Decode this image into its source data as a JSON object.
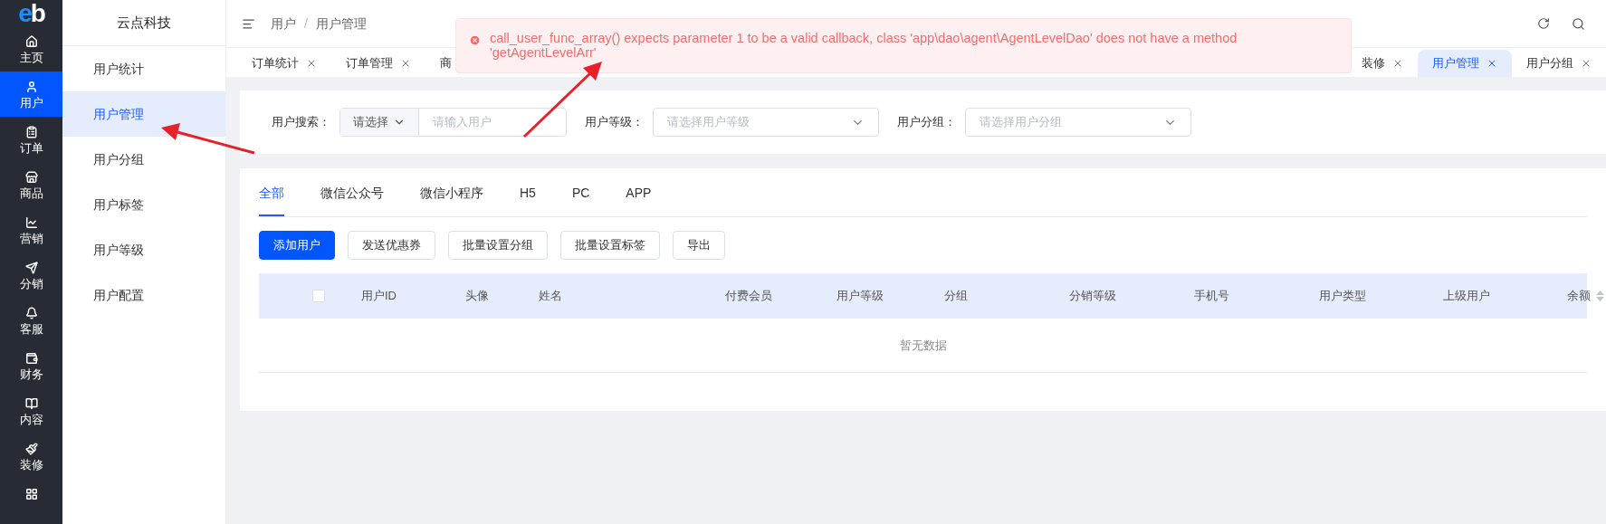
{
  "sidebar": {
    "logo_parts": [
      "e",
      "b"
    ],
    "items": [
      {
        "label": "主页",
        "selected": false
      },
      {
        "label": "用户",
        "selected": true
      },
      {
        "label": "订单",
        "selected": false
      },
      {
        "label": "商品",
        "selected": false
      },
      {
        "label": "营销",
        "selected": false
      },
      {
        "label": "分销",
        "selected": false
      },
      {
        "label": "客服",
        "selected": false
      },
      {
        "label": "财务",
        "selected": false
      },
      {
        "label": "内容",
        "selected": false
      },
      {
        "label": "装修",
        "selected": false
      },
      {
        "selected": false
      }
    ]
  },
  "submenu": {
    "title": "云点科技",
    "items": [
      {
        "label": "用户统计",
        "selected": false
      },
      {
        "label": "用户管理",
        "selected": true
      },
      {
        "label": "用户分组",
        "selected": false
      },
      {
        "label": "用户标签",
        "selected": false
      },
      {
        "label": "用户等级",
        "selected": false
      },
      {
        "label": "用户配置",
        "selected": false
      }
    ]
  },
  "header": {
    "breadcrumb": [
      "用户",
      "用户管理"
    ],
    "separator": "/"
  },
  "tabs": [
    {
      "label": "订单统计",
      "selected": false,
      "cut": false
    },
    {
      "label": "订单管理",
      "selected": false,
      "cut": false
    },
    {
      "label": "商",
      "selected": false,
      "cut": true
    },
    {
      "label": "装修",
      "selected": false,
      "cut": false
    },
    {
      "label": "用户管理",
      "selected": true,
      "cut": false
    },
    {
      "label": "用户分组",
      "selected": false,
      "cut": false
    }
  ],
  "error_toast": {
    "message": "call_user_func_array() expects parameter 1 to be a valid callback, class 'app\\dao\\agent\\AgentLevelDao' does not have a method 'getAgentLevelArr'"
  },
  "filters": {
    "user_search": {
      "label": "用户搜索：",
      "select_value": "请选择",
      "placeholder": "请输入用户"
    },
    "user_level": {
      "label": "用户等级：",
      "placeholder": "请选择用户等级"
    },
    "user_group": {
      "label": "用户分组：",
      "placeholder": "请选择用户分组"
    }
  },
  "channel_tabs": [
    {
      "label": "全部",
      "selected": true
    },
    {
      "label": "微信公众号",
      "selected": false
    },
    {
      "label": "微信小程序",
      "selected": false
    },
    {
      "label": "H5",
      "selected": false
    },
    {
      "label": "PC",
      "selected": false
    },
    {
      "label": "APP",
      "selected": false
    }
  ],
  "actions": [
    {
      "label": "添加用户",
      "kind": "primary"
    },
    {
      "label": "发送优惠券",
      "kind": "default"
    },
    {
      "label": "批量设置分组",
      "kind": "default"
    },
    {
      "label": "批量设置标签",
      "kind": "default"
    },
    {
      "label": "导出",
      "kind": "default"
    }
  ],
  "table": {
    "select_all": {
      "checked": false
    },
    "columns": [
      {
        "label": "用户ID",
        "sortable": false
      },
      {
        "label": "头像",
        "sortable": false
      },
      {
        "label": "姓名",
        "sortable": false
      },
      {
        "label": "付费会员",
        "sortable": false
      },
      {
        "label": "用户等级",
        "sortable": false
      },
      {
        "label": "分组",
        "sortable": false
      },
      {
        "label": "分销等级",
        "sortable": false
      },
      {
        "label": "手机号",
        "sortable": false
      },
      {
        "label": "用户类型",
        "sortable": false
      },
      {
        "label": "上级用户",
        "sortable": false
      },
      {
        "label": "余额",
        "sortable": true
      }
    ],
    "empty_text": "暂无数据"
  }
}
